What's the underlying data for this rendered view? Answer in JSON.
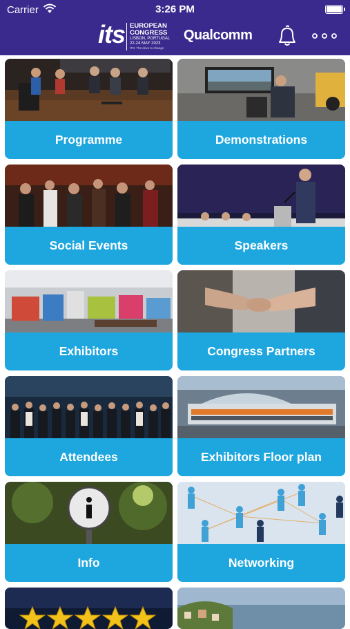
{
  "status_bar": {
    "carrier": "Carrier",
    "time": "3:26 PM"
  },
  "header": {
    "logo": {
      "mark": "its",
      "line1": "EUROPEAN",
      "line2": "CONGRESS",
      "line3": "LISBON, PORTUGAL",
      "line4": "22-24 MAY 2023",
      "line5": "ITS: The drive to change"
    },
    "sponsor": "Qualcomm",
    "icons": [
      "bell-icon",
      "more-icon"
    ]
  },
  "tiles": [
    {
      "label": "Programme",
      "photo": "panel-discussion"
    },
    {
      "label": "Demonstrations",
      "photo": "driving-simulator"
    },
    {
      "label": "Social Events",
      "photo": "crowd-party"
    },
    {
      "label": "Speakers",
      "photo": "speaker-podium"
    },
    {
      "label": "Exhibitors",
      "photo": "exhibition-hall"
    },
    {
      "label": "Congress Partners",
      "photo": "handshake"
    },
    {
      "label": "Attendees",
      "photo": "group-photo"
    },
    {
      "label": "Exhibitors Floor plan",
      "photo": "congress-venue"
    },
    {
      "label": "Info",
      "photo": "info-sign"
    },
    {
      "label": "Networking",
      "photo": "network-people"
    },
    {
      "label": "",
      "photo": "rating-stars"
    },
    {
      "label": "",
      "photo": "lisbon-view"
    }
  ],
  "colors": {
    "header": "#3b2a8e",
    "tile_band": "#1ea6df",
    "text": "#ffffff"
  }
}
